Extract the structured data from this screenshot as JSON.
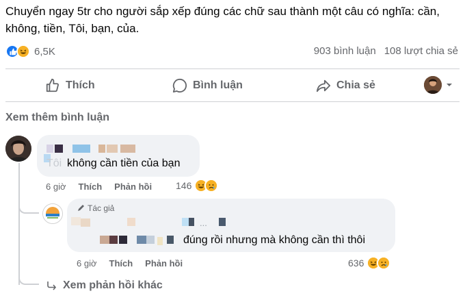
{
  "post": {
    "text": "Chuyển ngay 5tr cho người sắp xếp đúng các chữ sau thành một câu có nghĩa: cần, không, tiền, Tôi, bạn, của.",
    "reaction_count": "6,5K",
    "comments_count": "903 bình luận",
    "shares_count": "108 lượt chia sẻ"
  },
  "actions": {
    "like": "Thích",
    "comment": "Bình luận",
    "share": "Chia sẻ"
  },
  "comments_section": {
    "see_more": "Xem thêm bình luận"
  },
  "comment1": {
    "text_visible": "không cần tiền của bạn",
    "obscured_prefix": "Tôi",
    "time": "6 giờ",
    "like": "Thích",
    "reply": "Phản hồi",
    "reaction_count": "146"
  },
  "reply1": {
    "author_tag": "Tác giả",
    "line1_fragment": "...",
    "text": "đúng rồi nhưng mà không cần thì thôi",
    "time": "6 giờ",
    "like": "Thích",
    "reply": "Phản hồi",
    "reaction_count": "636"
  },
  "see_more_replies": "Xem phản hồi khác",
  "colors": {
    "brand_blue": "#1877f2",
    "secondary_text": "#65676b",
    "bubble_bg": "#f0f2f5",
    "divider": "#ced0d4"
  }
}
